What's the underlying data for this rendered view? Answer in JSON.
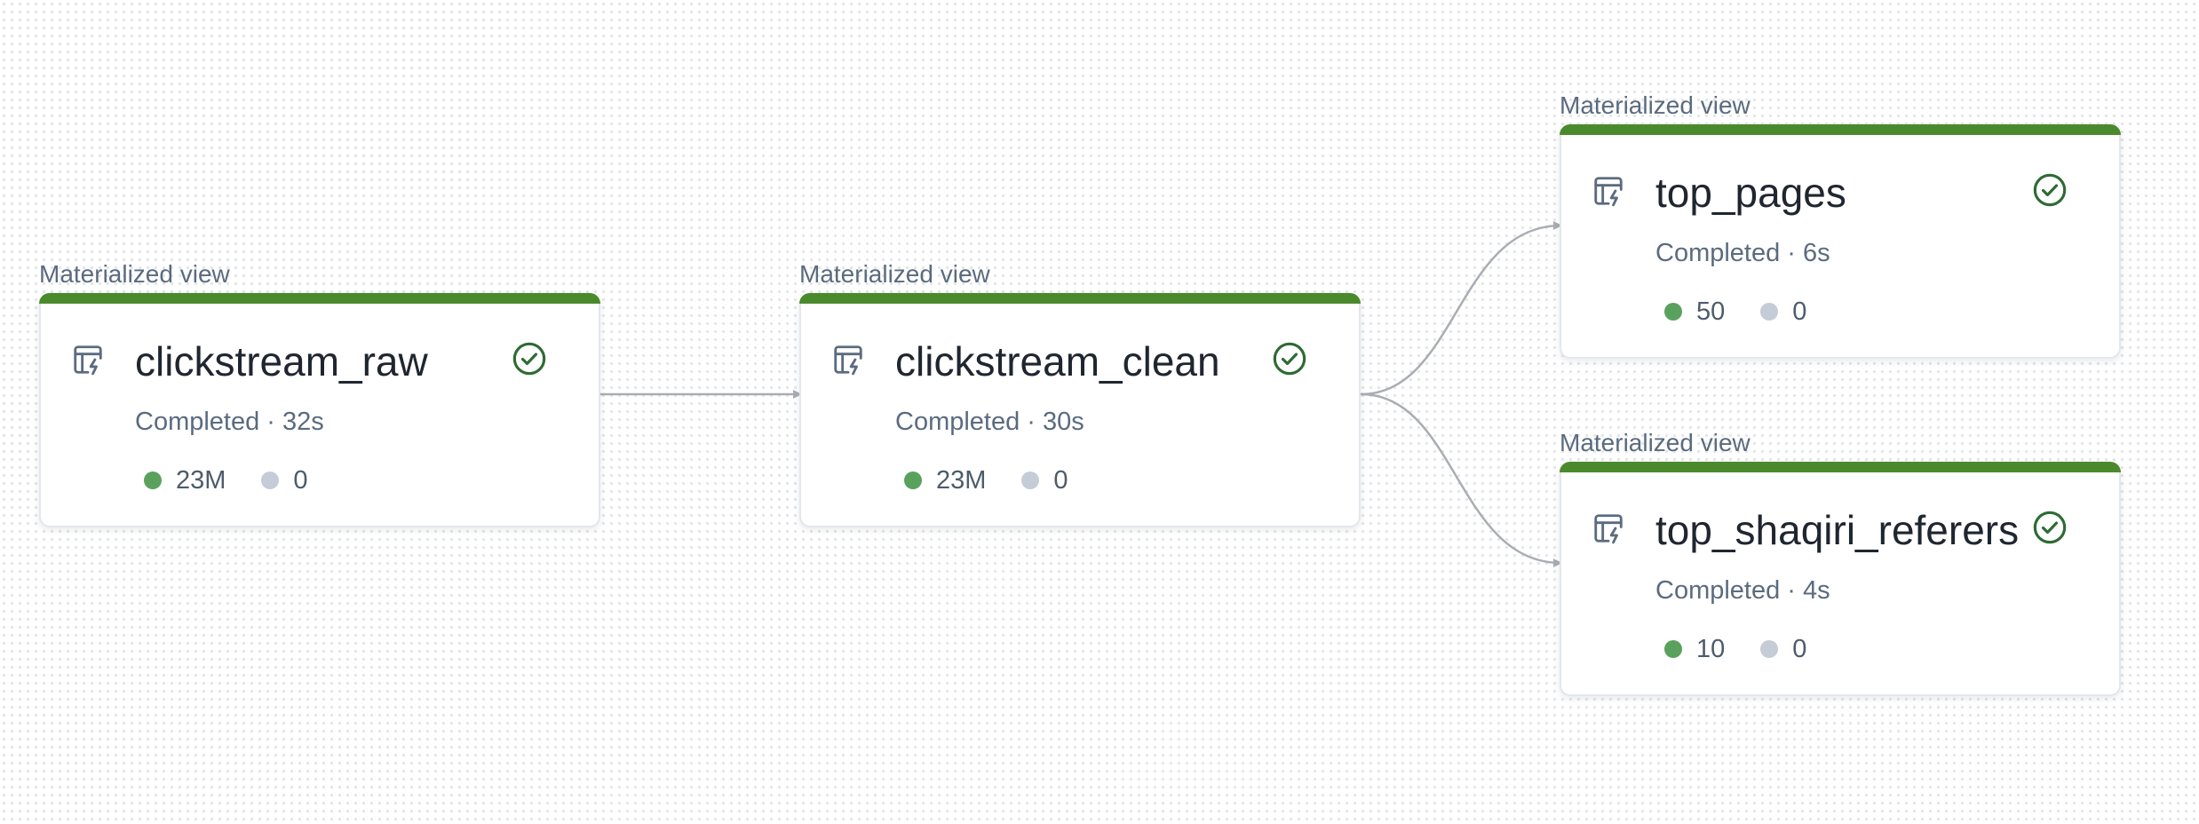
{
  "nodes": [
    {
      "id": "clickstream_raw",
      "type_label": "Materialized view",
      "name": "clickstream_raw",
      "status": "Completed · 32s",
      "metric_ok": "23M",
      "metric_other": "0",
      "icon": "materialized-view-icon",
      "status_icon": "check-circle-icon"
    },
    {
      "id": "clickstream_clean",
      "type_label": "Materialized view",
      "name": "clickstream_clean",
      "status": "Completed · 30s",
      "metric_ok": "23M",
      "metric_other": "0",
      "icon": "materialized-view-icon",
      "status_icon": "check-circle-icon"
    },
    {
      "id": "top_pages",
      "type_label": "Materialized view",
      "name": "top_pages",
      "status": "Completed · 6s",
      "metric_ok": "50",
      "metric_other": "0",
      "icon": "materialized-view-icon",
      "status_icon": "check-circle-icon"
    },
    {
      "id": "top_shaqiri_referers",
      "type_label": "Materialized view",
      "name": "top_shaqiri_referers",
      "status": "Completed · 4s",
      "metric_ok": "10",
      "metric_other": "0",
      "icon": "materialized-view-icon",
      "status_icon": "check-circle-icon"
    }
  ],
  "edges": [
    {
      "from": "clickstream_raw",
      "to": "clickstream_clean"
    },
    {
      "from": "clickstream_clean",
      "to": "top_pages"
    },
    {
      "from": "clickstream_clean",
      "to": "top_shaqiri_referers"
    }
  ],
  "colors": {
    "status_bar": "#4b8a2c",
    "success_icon": "#2e6b34",
    "metric_ok_dot": "#5aa15e",
    "metric_other_dot": "#c5ccd7",
    "edge": "#a9adb3"
  }
}
